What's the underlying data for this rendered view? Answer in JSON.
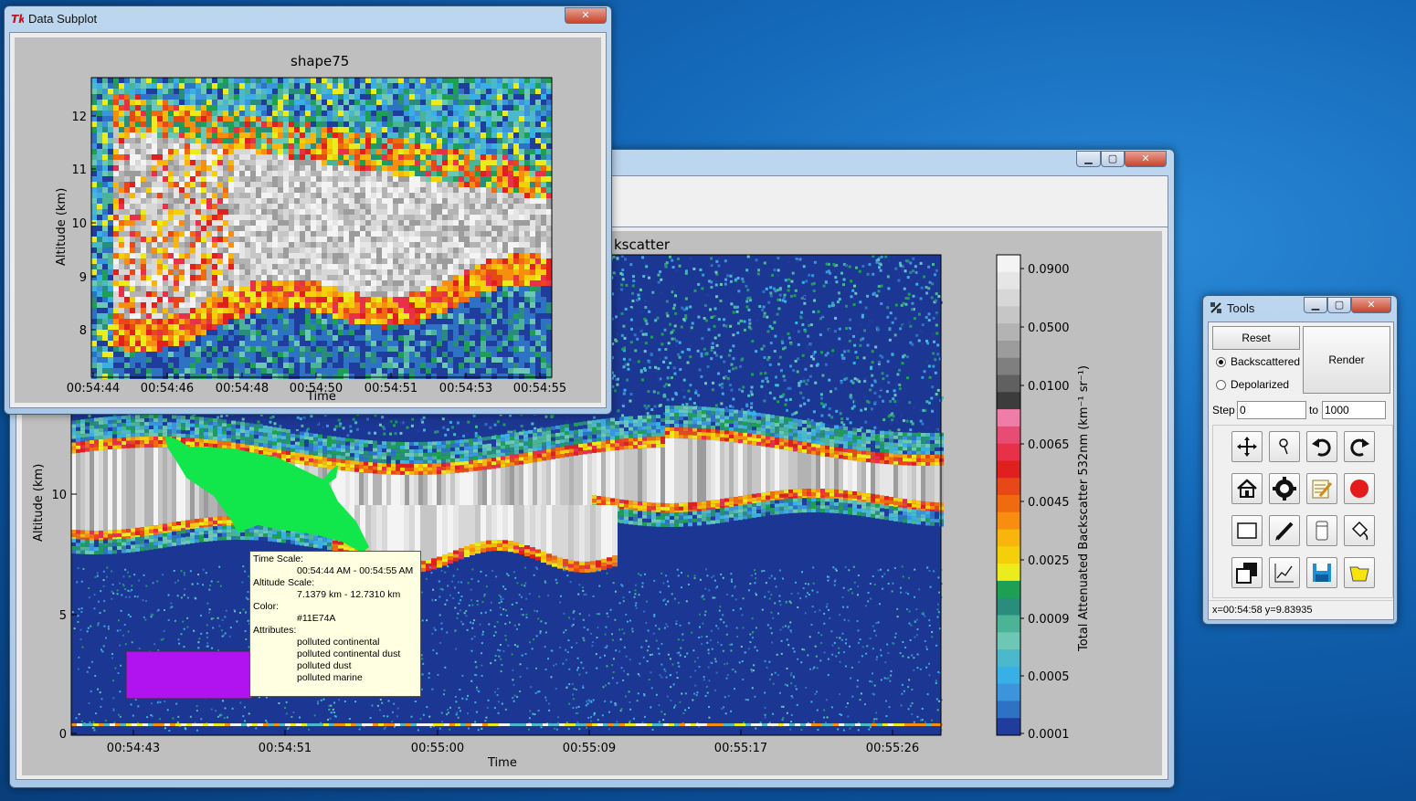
{
  "main_window": {
    "plot_title": "kscatter",
    "xlabel": "Time",
    "ylabel": "Altitude (km)",
    "xticks": [
      "00:54:43",
      "00:54:51",
      "00:55:00",
      "00:55:09",
      "00:55:17",
      "00:55:26"
    ],
    "yticks": [
      "0",
      "5",
      "10"
    ],
    "colorbar_label": "Total Attenuated Backscatter 532nm (km⁻¹ sr⁻¹)",
    "colorbar_ticks": [
      "0.0900",
      "0.0500",
      "0.0100",
      "0.0065",
      "0.0045",
      "0.0025",
      "0.0009",
      "0.0005",
      "0.0001"
    ],
    "colorbar_colors": [
      "#f4f4f4",
      "#e6e6e6",
      "#d7d7d7",
      "#c6c6c6",
      "#b3b3b3",
      "#9c9c9c",
      "#7f7f7f",
      "#606060",
      "#3c3c3c",
      "#f07ca8",
      "#e84c74",
      "#e83048",
      "#e0201e",
      "#e84818",
      "#f06a10",
      "#f88e10",
      "#f8b60c",
      "#f4d00a",
      "#ecec1c",
      "#1ea054",
      "#2a8c7c",
      "#4cb496",
      "#6cc8b4",
      "#4cb8cc",
      "#38b0e6",
      "#3c94dc",
      "#2e72c4",
      "#203c9c"
    ],
    "shape_color": "#11E74A",
    "rect_color": "#B012F0",
    "tooltip": {
      "time_label": "Time Scale:",
      "time_value": "00:54:44 AM - 00:54:55 AM",
      "alt_label": "Altitude Scale:",
      "alt_value": "7.1379 km - 12.7310 km",
      "color_label": "Color:",
      "color_value": "#11E74A",
      "attr_label": "Attributes:",
      "attributes": [
        "polluted continental",
        "polluted continental dust",
        "polluted dust",
        "polluted marine"
      ]
    }
  },
  "subplot_window": {
    "window_title": "Data Subplot",
    "plot_title": "shape75",
    "xlabel": "Time",
    "ylabel": "Altitude (km)",
    "xticks": [
      "00:54:44",
      "00:54:46",
      "00:54:48",
      "00:54:50",
      "00:54:51",
      "00:54:53",
      "00:54:55"
    ],
    "yticks": [
      "8",
      "9",
      "10",
      "11",
      "12"
    ]
  },
  "tools_window": {
    "window_title": "Tools",
    "reset_label": "Reset",
    "render_label": "Render",
    "radio_backscattered": "Backscattered",
    "radio_depolarized": "Depolarized",
    "step_label": "Step",
    "step_from": "0",
    "to_label": "to",
    "step_to": "1000",
    "tools": [
      "move-icon",
      "zoom-icon",
      "undo-icon",
      "redo-icon",
      "home-icon",
      "gear-icon",
      "notes-icon",
      "record-icon",
      "rectangle-icon",
      "pencil-icon",
      "eraser-icon",
      "paint-bucket-icon",
      "layers-icon",
      "plot-icon",
      "save-icon",
      "open-folder-icon"
    ],
    "status_text": "x=00:54:58 y=9.83935"
  }
}
